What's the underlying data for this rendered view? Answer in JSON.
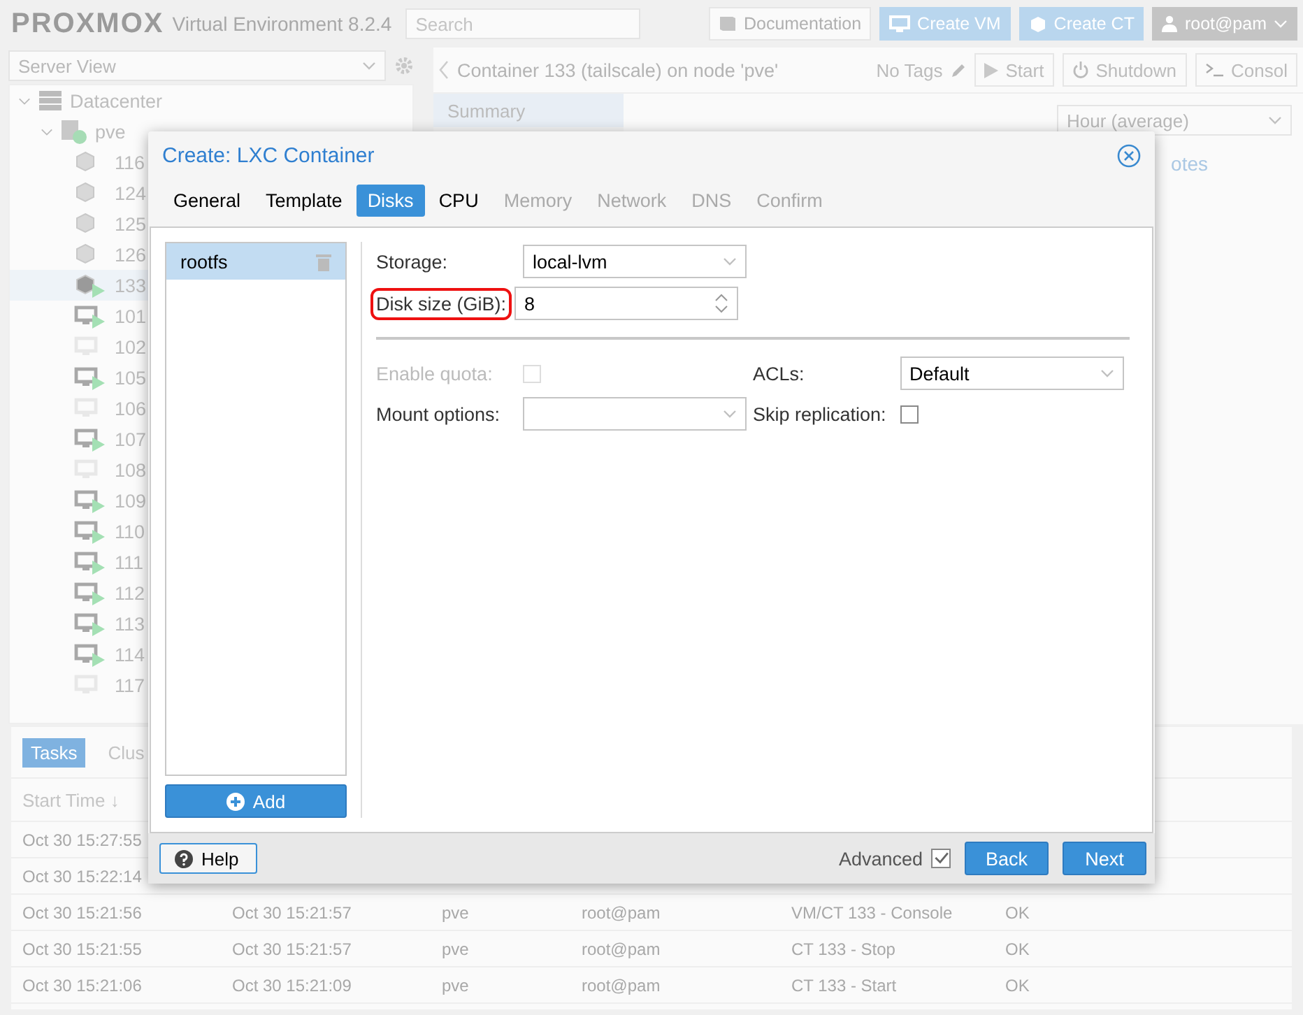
{
  "header": {
    "brand": "PROXMOX",
    "product": "Virtual Environment 8.2.4",
    "search": {
      "placeholder": "Search"
    },
    "buttons": [
      {
        "kind": "docs",
        "label": "Documentation"
      },
      {
        "kind": "vm",
        "label": "Create VM"
      },
      {
        "kind": "ct",
        "label": "Create CT"
      },
      {
        "kind": "user",
        "label": "root@pam"
      }
    ]
  },
  "sidebar": {
    "view": "Server View",
    "tree": {
      "label": "Datacenter",
      "expanded": true,
      "children": [
        {
          "label": "pve",
          "expanded": true,
          "children": [
            {
              "label": "116",
              "kind": "ct",
              "running": false,
              "selected": false
            },
            {
              "label": "124",
              "kind": "ct",
              "running": false,
              "selected": false
            },
            {
              "label": "125",
              "kind": "ct",
              "running": false,
              "selected": false
            },
            {
              "label": "126",
              "kind": "ct",
              "running": false,
              "selected": false
            },
            {
              "label": "133",
              "kind": "ct",
              "running": true,
              "selected": true
            },
            {
              "label": "101",
              "kind": "vm",
              "running": true,
              "selected": false
            },
            {
              "label": "102",
              "kind": "vm",
              "running": false,
              "selected": false
            },
            {
              "label": "105",
              "kind": "vm",
              "running": true,
              "selected": false
            },
            {
              "label": "106",
              "kind": "vm",
              "running": false,
              "selected": false
            },
            {
              "label": "107",
              "kind": "vm",
              "running": true,
              "selected": false
            },
            {
              "label": "108",
              "kind": "vm",
              "running": false,
              "selected": false
            },
            {
              "label": "109",
              "kind": "vm",
              "running": true,
              "selected": false
            },
            {
              "label": "110",
              "kind": "vm",
              "running": true,
              "selected": false
            },
            {
              "label": "111",
              "kind": "vm",
              "running": true,
              "selected": false
            },
            {
              "label": "112",
              "kind": "vm",
              "running": true,
              "selected": false
            },
            {
              "label": "113",
              "kind": "vm",
              "running": true,
              "selected": false
            },
            {
              "label": "114",
              "kind": "vm",
              "running": true,
              "selected": false
            },
            {
              "label": "117",
              "kind": "vm",
              "running": false,
              "selected": false
            }
          ]
        }
      ]
    }
  },
  "content": {
    "title": "Container 133 (tailscale) on node 'pve'",
    "tags": "No Tags",
    "actions": [
      {
        "kind": "start",
        "label": "Start"
      },
      {
        "kind": "shutdown",
        "label": "Shutdown"
      },
      {
        "kind": "console",
        "label": "Consol"
      }
    ],
    "nav": [
      {
        "label": "Summary",
        "selected": true
      }
    ],
    "timeframe": "Hour (average)",
    "panel_title": "otes"
  },
  "tasks": {
    "tabs": [
      {
        "label": "Tasks",
        "selected": true
      },
      {
        "label": "Clus",
        "selected": false
      }
    ],
    "columns": [
      "Start Time ↓"
    ],
    "rows": [
      [
        "Oct 30 15:27:55"
      ],
      [
        "Oct 30 15:22:14"
      ],
      [
        "Oct 30 15:21:56",
        "Oct 30 15:21:57",
        "pve",
        "root@pam",
        "VM/CT 133 - Console",
        "OK"
      ],
      [
        "Oct 30 15:21:55",
        "Oct 30 15:21:57",
        "pve",
        "root@pam",
        "CT 133 - Stop",
        "OK"
      ],
      [
        "Oct 30 15:21:06",
        "Oct 30 15:21:09",
        "pve",
        "root@pam",
        "CT 133 - Start",
        "OK"
      ]
    ]
  },
  "dialog": {
    "title": "Create: LXC Container",
    "tabs": [
      {
        "label": "General",
        "selected": false,
        "disabled": false
      },
      {
        "label": "Template",
        "selected": false,
        "disabled": false
      },
      {
        "label": "Disks",
        "selected": true,
        "disabled": false
      },
      {
        "label": "CPU",
        "selected": false,
        "disabled": false
      },
      {
        "label": "Memory",
        "selected": false,
        "disabled": true
      },
      {
        "label": "Network",
        "selected": false,
        "disabled": true
      },
      {
        "label": "DNS",
        "selected": false,
        "disabled": true
      },
      {
        "label": "Confirm",
        "selected": false,
        "disabled": true
      }
    ],
    "disks": [
      {
        "label": "rootfs",
        "selected": true
      }
    ],
    "add_button": "Add",
    "fields_top": [
      {
        "label": "Storage:",
        "kind": "select",
        "value": "local-lvm",
        "highlighted": false
      },
      {
        "label": "Disk size (GiB):",
        "kind": "spinner",
        "value": "8",
        "highlighted": true
      }
    ],
    "fields_left": [
      {
        "label": "Enable quota:",
        "kind": "checkbox",
        "checked": false,
        "disabled": true
      },
      {
        "label": "Mount options:",
        "kind": "select",
        "disabled": false
      }
    ],
    "fields_right": [
      {
        "label": "ACLs:",
        "kind": "select",
        "value": "Default",
        "disabled": false
      },
      {
        "label": "Skip replication:",
        "kind": "checkbox",
        "checked": false,
        "disabled": false
      }
    ],
    "help": "Help",
    "advanced": {
      "label": "Advanced",
      "checked": true
    },
    "buttons": [
      "Back",
      "Next"
    ]
  }
}
